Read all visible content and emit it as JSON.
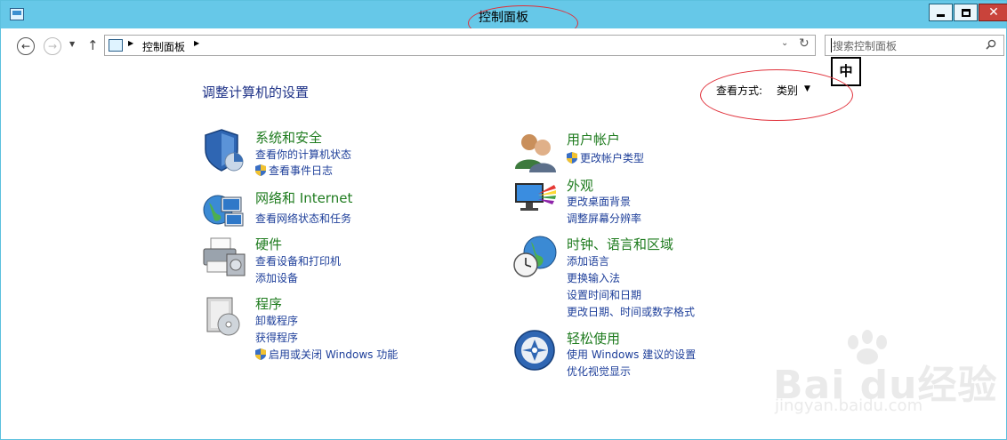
{
  "window": {
    "title": "控制面板"
  },
  "nav": {
    "back_icon": "back-arrow-icon",
    "forward_icon": "forward-arrow-icon",
    "up_icon": "up-arrow-icon"
  },
  "address": {
    "crumb": "控制面板"
  },
  "search": {
    "placeholder": "搜索控制面板"
  },
  "ime": {
    "label": "中"
  },
  "main": {
    "heading": "调整计算机的设置",
    "view_by_label": "查看方式:",
    "view_by_value": "类别"
  },
  "categories": [
    {
      "title": "系统和安全",
      "icon": "shield-icon",
      "links": [
        {
          "label": "查看你的计算机状态"
        },
        {
          "label": "查看事件日志",
          "shield": true
        }
      ]
    },
    {
      "title": "网络和 Internet",
      "icon": "network-globe-icon",
      "links": [
        {
          "label": "查看网络状态和任务"
        }
      ]
    },
    {
      "title": "硬件",
      "icon": "printer-icon",
      "links": [
        {
          "label": "查看设备和打印机"
        },
        {
          "label": "添加设备"
        }
      ]
    },
    {
      "title": "程序",
      "icon": "programs-box-icon",
      "links": [
        {
          "label": "卸载程序"
        },
        {
          "label": "获得程序"
        },
        {
          "label": "启用或关闭 Windows 功能",
          "shield": true
        }
      ]
    },
    {
      "title": "用户帐户",
      "icon": "users-icon",
      "links": [
        {
          "label": "更改帐户类型",
          "shield": true
        }
      ]
    },
    {
      "title": "外观",
      "icon": "appearance-monitor-icon",
      "links": [
        {
          "label": "更改桌面背景"
        },
        {
          "label": "调整屏幕分辨率"
        }
      ]
    },
    {
      "title": "时钟、语言和区域",
      "icon": "clock-globe-icon",
      "links": [
        {
          "label": "添加语言"
        },
        {
          "label": "更换输入法"
        },
        {
          "label": "设置时间和日期"
        },
        {
          "label": "更改日期、时间或数字格式"
        }
      ]
    },
    {
      "title": "轻松使用",
      "icon": "ease-of-access-icon",
      "links": [
        {
          "label": "使用 Windows 建议的设置"
        },
        {
          "label": "优化视觉显示"
        }
      ]
    }
  ],
  "watermark": {
    "brand": "Bai du经验",
    "url": "jingyan.baidu.com"
  },
  "colors": {
    "titlebar": "#66c8e8",
    "heading": "#1e3287",
    "category_title": "#1e7b1e",
    "link": "#1e3f9a",
    "annotation": "#e0303a"
  }
}
